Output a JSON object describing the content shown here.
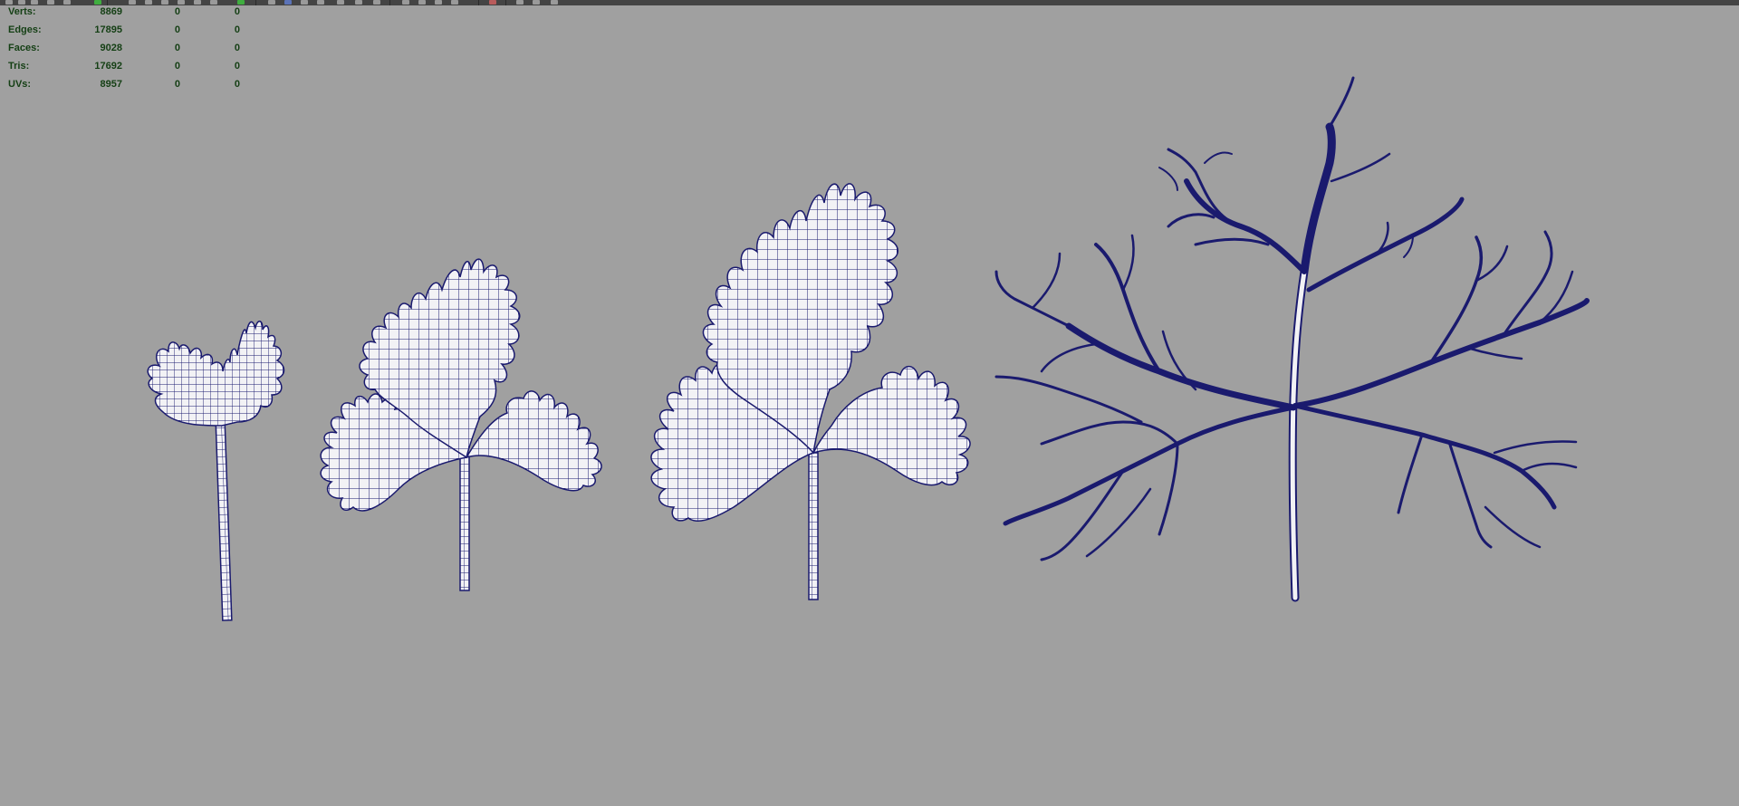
{
  "hud": {
    "rows": [
      {
        "label": "Verts:",
        "values": [
          "8869",
          "0",
          "0"
        ]
      },
      {
        "label": "Edges:",
        "values": [
          "17895",
          "0",
          "0"
        ]
      },
      {
        "label": "Faces:",
        "values": [
          "9028",
          "0",
          "0"
        ]
      },
      {
        "label": "Tris:",
        "values": [
          "17692",
          "0",
          "0"
        ]
      },
      {
        "label": "UVs:",
        "values": [
          "8957",
          "0",
          "0"
        ]
      }
    ]
  },
  "colors": {
    "viewport_bg": "#a0a0a0",
    "wire": "#1a1a6e",
    "surface": "#f2f2f5",
    "hud_text": "#143f14",
    "toolbar_bg": "#444444"
  },
  "viewport": {
    "objects": [
      {
        "name": "small-leaf-mesh",
        "kind": "leaf",
        "icon": "leaf-wireframe"
      },
      {
        "name": "medium-leaf-mesh",
        "kind": "leaf",
        "icon": "leaf-wireframe"
      },
      {
        "name": "large-leaf-mesh",
        "kind": "leaf",
        "icon": "leaf-wireframe"
      },
      {
        "name": "branch-skeleton-mesh",
        "kind": "branch",
        "icon": "branch-wireframe"
      }
    ]
  }
}
